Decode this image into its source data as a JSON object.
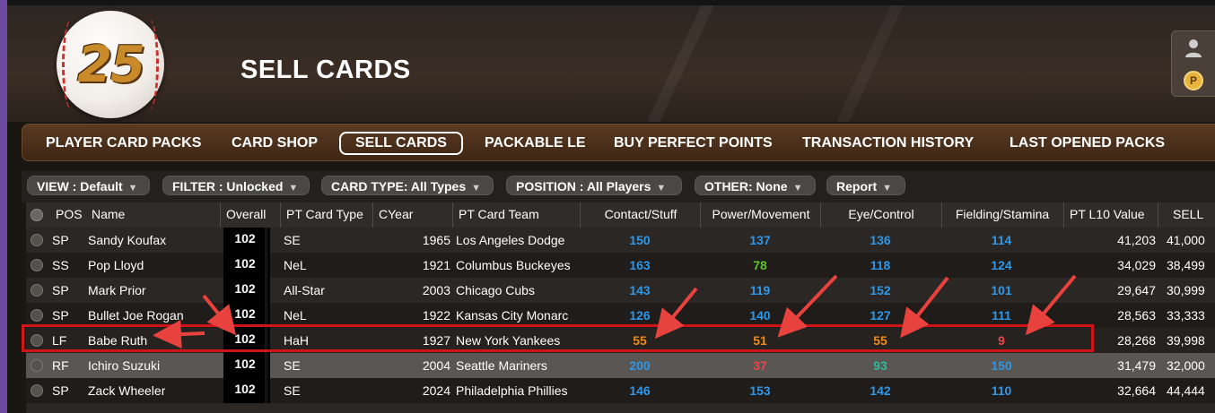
{
  "app": {
    "logo_text": "25",
    "page_title": "SELL CARDS"
  },
  "nav": {
    "items": [
      {
        "label": "PLAYER CARD PACKS",
        "active": false
      },
      {
        "label": "CARD SHOP",
        "active": false
      },
      {
        "label": "SELL CARDS",
        "active": true
      },
      {
        "label": "PACKABLE LE",
        "active": false
      },
      {
        "label": "BUY PERFECT POINTS",
        "active": false
      },
      {
        "label": "TRANSACTION HISTORY",
        "active": false
      },
      {
        "label": "LAST OPENED PACKS",
        "active": false
      }
    ]
  },
  "filters": [
    {
      "label": "VIEW : Default"
    },
    {
      "label": "FILTER : Unlocked"
    },
    {
      "label": "CARD TYPE: All Types"
    },
    {
      "label": "POSITION : All Players"
    },
    {
      "label": "OTHER: None"
    },
    {
      "label": "Report"
    }
  ],
  "table": {
    "columns": [
      "POS",
      "Name",
      "Overall",
      "PT Card Type",
      "CYear",
      "PT Card Team",
      "Contact/Stuff",
      "Power/Movement",
      "Eye/Control",
      "Fielding/Stamina",
      "PT L10 Value",
      "SELL"
    ],
    "rows": [
      {
        "pos": "SP",
        "name": "Sandy Koufax",
        "overall": "102",
        "type": "SE",
        "year": "1965",
        "team": "Los Angeles Dodge",
        "c1": "150",
        "c2": "137",
        "c3": "136",
        "c4": "114",
        "value": "41,203",
        "sell": "41,000"
      },
      {
        "pos": "SS",
        "name": "Pop Lloyd",
        "overall": "102",
        "type": "NeL",
        "year": "1921",
        "team": "Columbus Buckeyes",
        "c1": "163",
        "c2": "78",
        "c3": "118",
        "c4": "124",
        "value": "34,029",
        "sell": "38,499"
      },
      {
        "pos": "SP",
        "name": "Mark Prior",
        "overall": "102",
        "type": "All-Star",
        "year": "2003",
        "team": "Chicago Cubs",
        "c1": "143",
        "c2": "119",
        "c3": "152",
        "c4": "101",
        "value": "29,647",
        "sell": "30,999"
      },
      {
        "pos": "SP",
        "name": "Bullet Joe Rogan",
        "overall": "102",
        "type": "NeL",
        "year": "1922",
        "team": "Kansas City Monarc",
        "c1": "126",
        "c2": "140",
        "c3": "127",
        "c4": "111",
        "value": "28,563",
        "sell": "33,333"
      },
      {
        "pos": "LF",
        "name": "Babe Ruth",
        "overall": "102",
        "type": "HaH",
        "year": "1927",
        "team": "New York Yankees",
        "c1": "55",
        "c2": "51",
        "c3": "55",
        "c4": "9",
        "value": "28,268",
        "sell": "39,998"
      },
      {
        "pos": "RF",
        "name": "Ichiro Suzuki",
        "overall": "102",
        "type": "SE",
        "year": "2004",
        "team": "Seattle Mariners",
        "c1": "200",
        "c2": "37",
        "c3": "93",
        "c4": "150",
        "value": "31,479",
        "sell": "32,000"
      },
      {
        "pos": "SP",
        "name": "Zack Wheeler",
        "overall": "102",
        "type": "SE",
        "year": "2024",
        "team": "Philadelphia Phillies",
        "c1": "146",
        "c2": "153",
        "c3": "142",
        "c4": "110",
        "value": "32,664",
        "sell": "44,444"
      }
    ],
    "cell_colors": {
      "blue": "#2f97e6",
      "green": "#5fc232",
      "teal": "#2fb89a",
      "orange": "#f08c1a",
      "red": "#e8454a"
    }
  }
}
